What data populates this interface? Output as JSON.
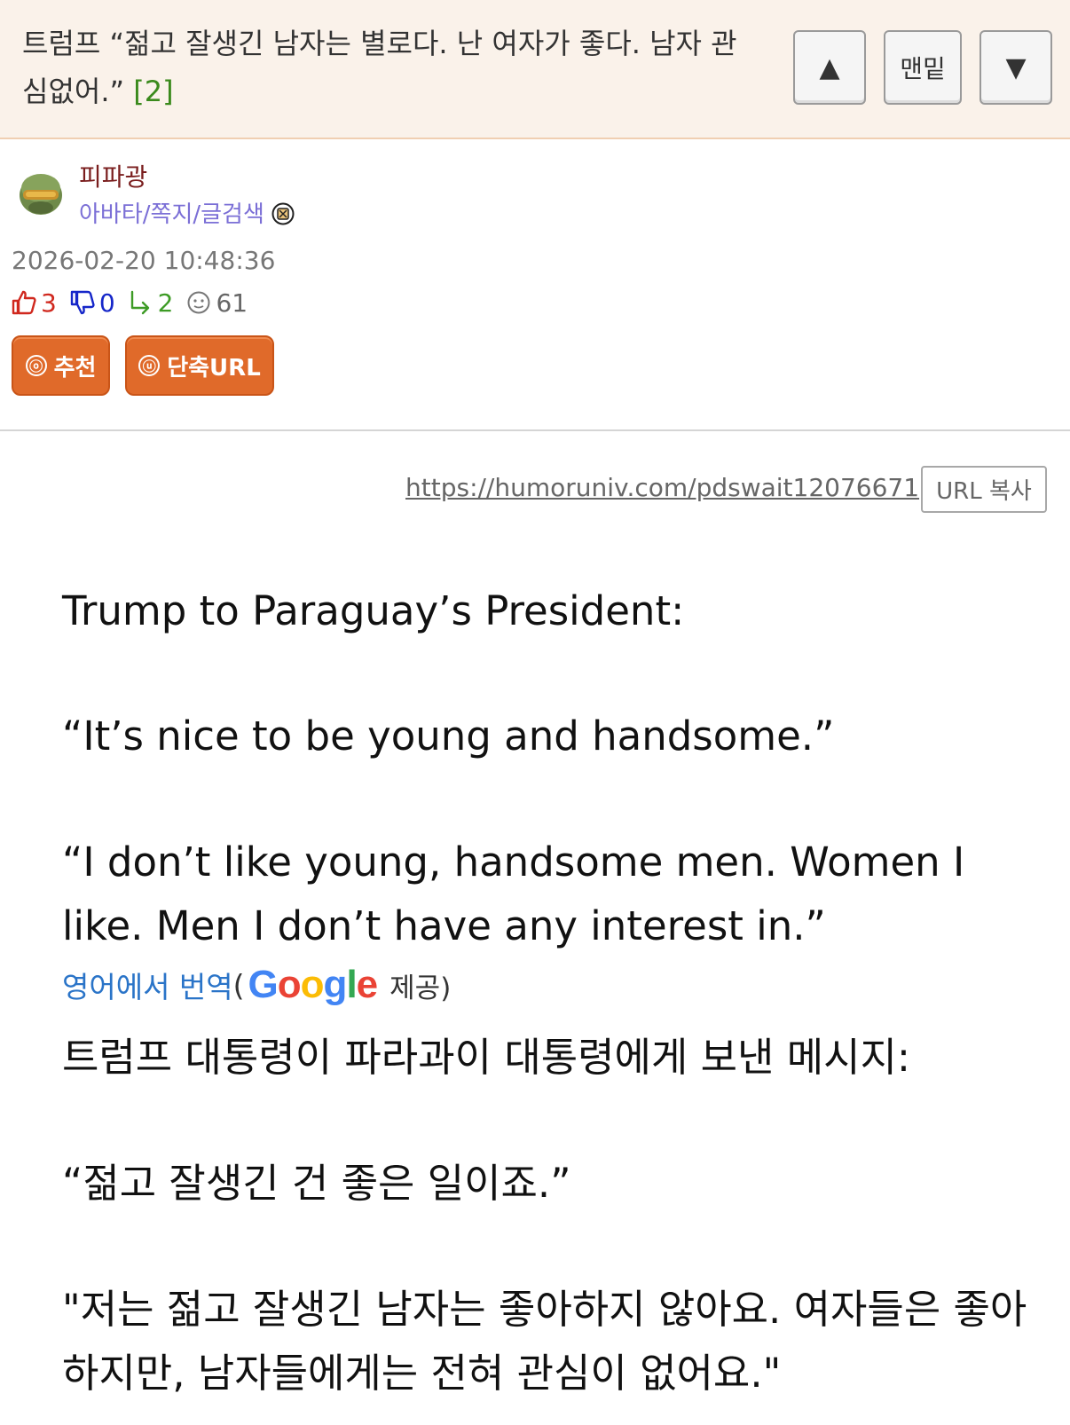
{
  "header": {
    "title": "트럼프 “젊고 잘생긴 남자는 별로다. 난 여자가 좋다. 남자 관심없어.”",
    "comment_count": "[2]",
    "up_label": "▲",
    "bottom_label": "맨밑",
    "down_label": "▼"
  },
  "author": {
    "name": "피파광",
    "links": "아바타/쪽지/글검색",
    "avatar_icon": "helmet-avatar-icon",
    "level_icon": "level-badge-icon"
  },
  "meta": {
    "date": "2026-02-20 10:48:36",
    "upvotes": "3",
    "downvotes": "0",
    "replies": "2",
    "views": "61"
  },
  "actions": {
    "recommend_icon": "ⓞ",
    "recommend": "추천",
    "short_url_icon": "ⓤ",
    "short_url": "단축URL"
  },
  "url": {
    "link": "https://humoruniv.com/pdswait12076671",
    "copy_label": "URL 복사"
  },
  "post": {
    "en_line1": "Trump to Paraguay’s President:",
    "en_line2": "“It’s nice to be young and handsome.”",
    "en_line3": "“I don’t like young, handsome men. Women I like. Men I don’t have any interest in.”",
    "translate_label": "영어에서 번역",
    "paren_open": "(",
    "provider": "Google",
    "provided_by": "제공)",
    "ko_line1": "트럼프 대통령이 파라과이 대통령에게 보낸 메시지:",
    "ko_line2": "“젊고 잘생긴 건 좋은 일이죠.”",
    "ko_line3": "\"저는 젊고 잘생긴 남자는 좋아하지 않아요. 여자들은 좋아하지만, 남자들에게는 전혀 관심이 없어요.\""
  },
  "colors": {
    "header_bg": "#faf2ea",
    "button_orange": "#e06a2a",
    "author_name": "#7a1e1e",
    "link_purple": "#7b6fd6",
    "up_red": "#d0281e",
    "down_blue": "#1526c9",
    "reply_green": "#3d9b25"
  }
}
